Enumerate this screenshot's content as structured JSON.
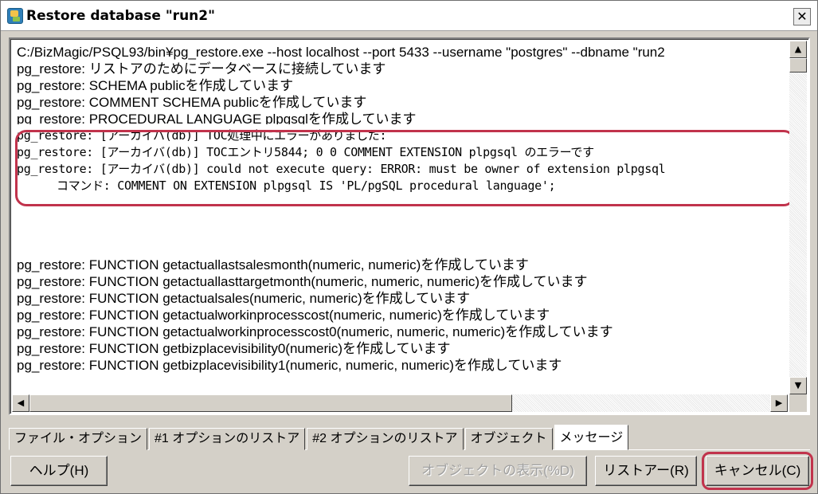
{
  "window": {
    "title": "Restore database \"run2\"",
    "close_label": "✕"
  },
  "log": {
    "lines_top": [
      "C:/BizMagic/PSQL93/bin¥pg_restore.exe --host localhost --port 5433 --username \"postgres\" --dbname \"run2",
      "pg_restore: リストアのためにデータベースに接続しています",
      "pg_restore: SCHEMA publicを作成しています",
      "pg_restore: COMMENT SCHEMA publicを作成しています",
      "pg_restore: PROCEDURAL LANGUAGE plpgsqlを作成しています"
    ],
    "error_lines": [
      "pg_restore: [アーカイバ(db)] TOC処理中にエラーがありました:",
      "pg_restore: [アーカイバ(db)] TOCエントリ5844; 0 0 COMMENT EXTENSION plpgsql のエラーです",
      "pg_restore: [アーカイバ(db)] could not execute query: ERROR:  must be owner of extension plpgsql",
      "コマンド: COMMENT ON EXTENSION plpgsql IS 'PL/pgSQL procedural language';"
    ],
    "lines_bottom": [
      "pg_restore: FUNCTION getactuallastsalesmonth(numeric, numeric)を作成しています",
      "pg_restore: FUNCTION getactuallasttargetmonth(numeric, numeric, numeric)を作成しています",
      "pg_restore: FUNCTION getactualsales(numeric, numeric)を作成しています",
      "pg_restore: FUNCTION getactualworkinprocesscost(numeric, numeric)を作成しています",
      "pg_restore: FUNCTION getactualworkinprocesscost0(numeric, numeric, numeric)を作成しています",
      "pg_restore: FUNCTION getbizplacevisibility0(numeric)を作成しています",
      "pg_restore: FUNCTION getbizplacevisibility1(numeric, numeric, numeric)を作成しています"
    ]
  },
  "tabs": [
    "ファイル・オプション",
    "#1 オプションのリストア",
    "#2 オプションのリストア",
    "オブジェクト",
    "メッセージ"
  ],
  "buttons": {
    "help": "ヘルプ(H)",
    "show_objects": "オブジェクトの表示(%D)",
    "restore": "リストアー(R)",
    "cancel": "キャンセル(C)"
  },
  "colors": {
    "highlight": "#c1334c"
  }
}
